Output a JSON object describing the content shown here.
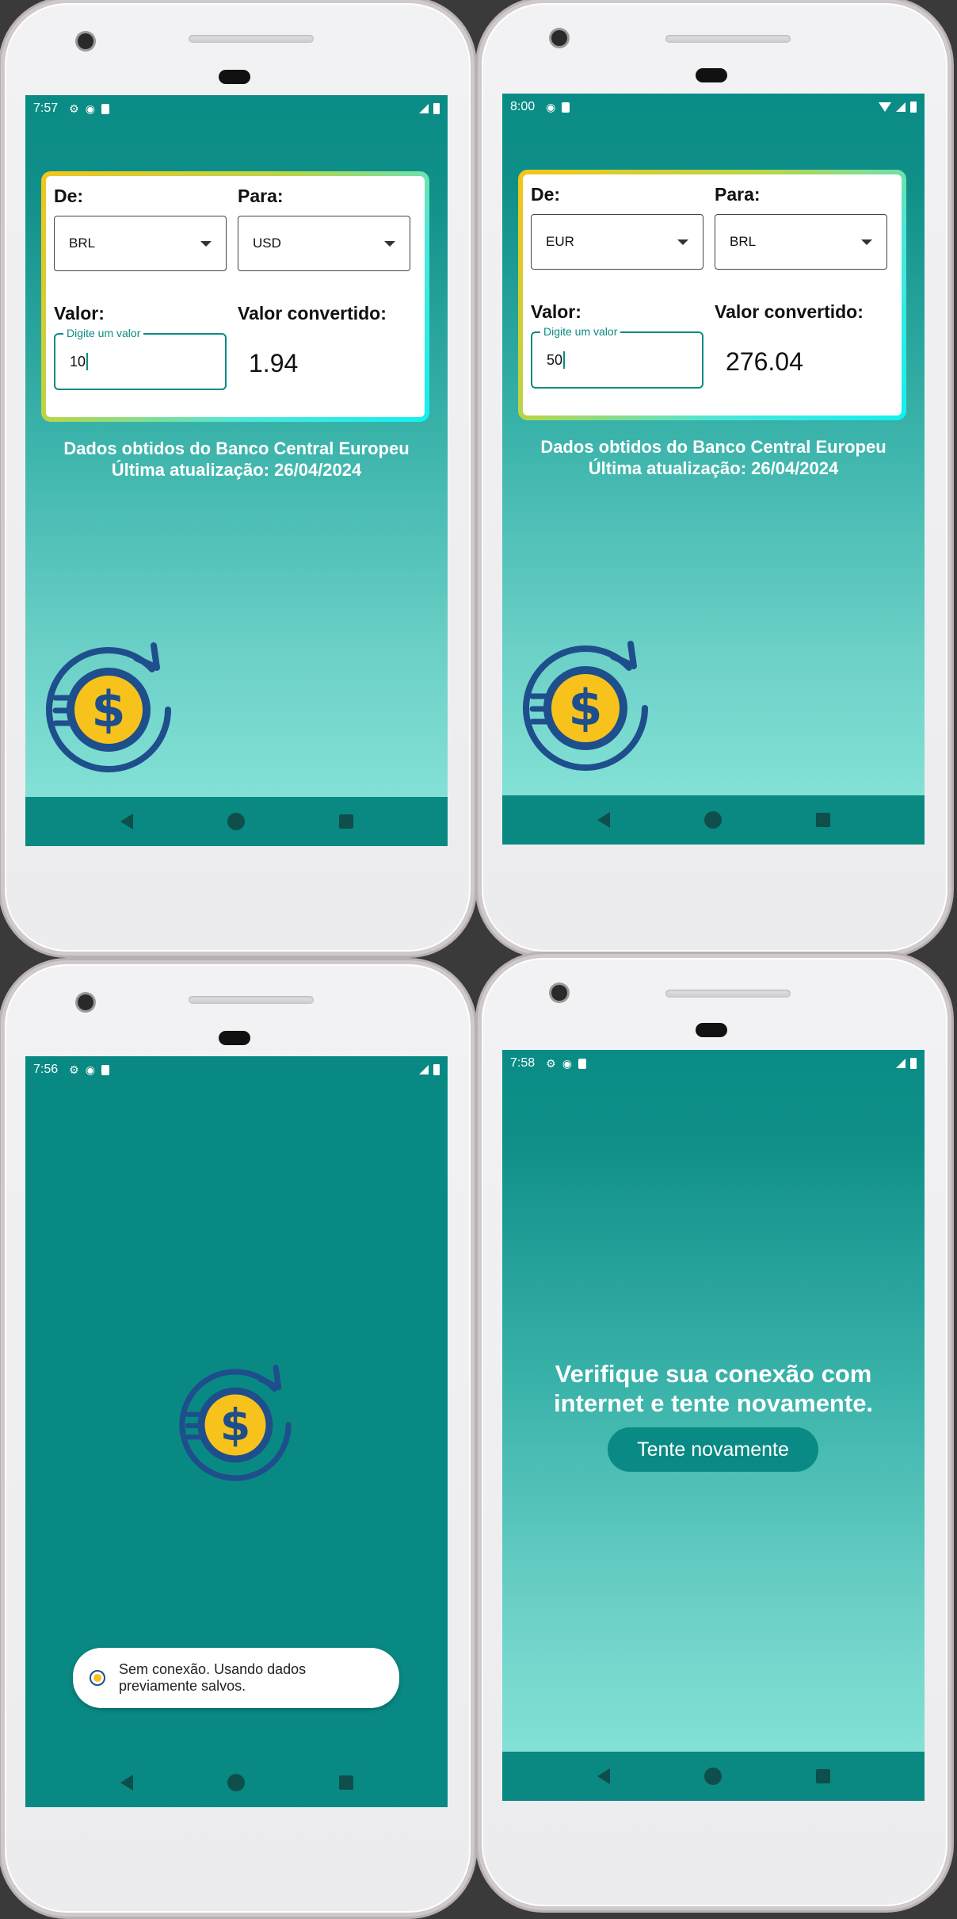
{
  "screens": [
    {
      "status_time": "7:57",
      "from_label": "De:",
      "to_label": "Para:",
      "from_currency": "BRL",
      "to_currency": "USD",
      "value_label": "Valor:",
      "converted_label": "Valor convertido:",
      "input_legend": "Digite um valor",
      "input_value": "10",
      "converted_value": "1.94",
      "source_line": "Dados obtidos do Banco Central Europeu",
      "updated_line": "Última atualização: 26/04/2024"
    },
    {
      "status_time": "8:00",
      "from_label": "De:",
      "to_label": "Para:",
      "from_currency": "EUR",
      "to_currency": "BRL",
      "value_label": "Valor:",
      "converted_label": "Valor convertido:",
      "input_legend": "Digite um valor",
      "input_value": "50",
      "converted_value": "276.04",
      "source_line": "Dados obtidos do Banco Central Europeu",
      "updated_line": "Última atualização: 26/04/2024"
    },
    {
      "status_time": "7:56",
      "toast_line1": "Sem conexão. Usando dados",
      "toast_line2": "previamente salvos."
    },
    {
      "status_time": "7:58",
      "error_line1": "Verifique sua conexão com",
      "error_line2": "internet e tente novamente.",
      "retry_label": "Tente novamente"
    }
  ],
  "colors": {
    "primary": "#098983",
    "accent_yellow": "#f8c21c",
    "logo_blue": "#1e4e8c"
  }
}
